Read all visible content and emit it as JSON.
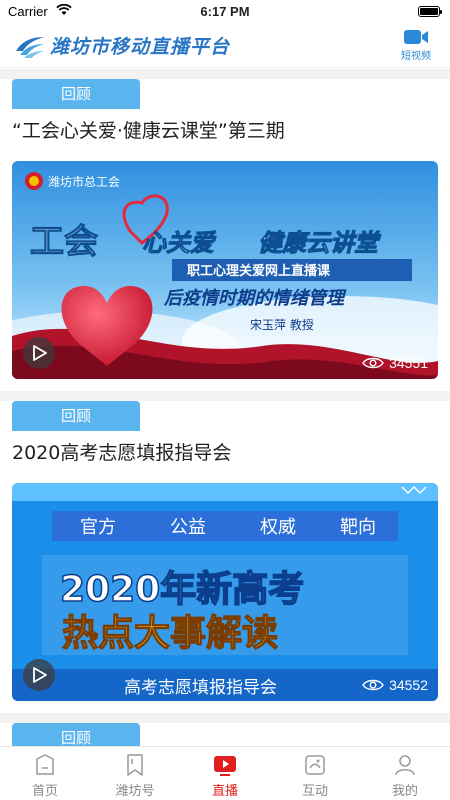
{
  "status_bar": {
    "carrier": "Carrier",
    "time": "6:17 PM"
  },
  "header": {
    "title": "潍坊市移动直播平台",
    "short_video_label": "短视频"
  },
  "feed": [
    {
      "tag": "回顾",
      "title": "“工会心关爱·健康云课堂”第三期",
      "views": "34551",
      "poster": {
        "org": "潍坊市总工会",
        "headline_left": "工会",
        "headline_mid": "心关爱",
        "headline_right": "健康云讲堂",
        "ribbon": "职工心理关爱网上直播课",
        "subtitle": "后疫情时期的情绪管理",
        "speaker": "宋玉萍  教授"
      }
    },
    {
      "tag": "回顾",
      "title": "2020高考志愿填报指导会",
      "views": "34552",
      "poster": {
        "keywords": [
          "官方",
          "公益",
          "权威",
          "靶向"
        ],
        "line1": "2020年新高考",
        "line2": "热点大事解读",
        "footer": "高考志愿填报指导会"
      }
    },
    {
      "tag": "回顾"
    }
  ],
  "tabbar": {
    "items": [
      {
        "label": "首页"
      },
      {
        "label": "潍坊号"
      },
      {
        "label": "直播",
        "active": true
      },
      {
        "label": "互动"
      },
      {
        "label": "我的"
      }
    ]
  },
  "colors": {
    "accent": "#e02020",
    "tag_blue": "#5ab4ee",
    "brand_blue": "#2a76c6"
  }
}
